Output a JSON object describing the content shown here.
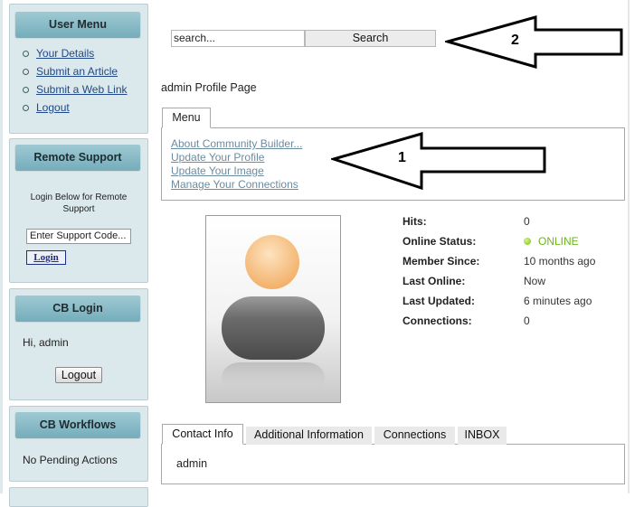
{
  "sidebar": {
    "user_menu": {
      "title": "User Menu",
      "links": [
        "Your Details",
        "Submit an Article",
        "Submit a Web Link",
        "Logout"
      ]
    },
    "remote_support": {
      "title": "Remote Support",
      "instructions": "Login Below for Remote Support",
      "code_placeholder": "Enter Support Code...",
      "login_label": "Login"
    },
    "cb_login": {
      "title": "CB Login",
      "greeting": "Hi, admin",
      "logout_label": "Logout"
    },
    "cb_workflows": {
      "title": "CB Workflows",
      "status": "No Pending Actions"
    }
  },
  "search": {
    "value": "search...",
    "button_label": "Search"
  },
  "page_title": "admin Profile Page",
  "menu": {
    "tab_label": "Menu",
    "links": [
      "About Community Builder...",
      "Update Your Profile",
      "Update Your Image",
      "Manage Your Connections"
    ]
  },
  "profile_stats": [
    {
      "label": "Hits:",
      "value": "0"
    },
    {
      "label": "Online Status:",
      "value": "ONLINE"
    },
    {
      "label": "Member Since:",
      "value": "10 months ago"
    },
    {
      "label": "Last Online:",
      "value": "Now"
    },
    {
      "label": "Last Updated:",
      "value": "6 minutes ago"
    },
    {
      "label": "Connections:",
      "value": "0"
    }
  ],
  "bottom_tabs": {
    "items": [
      "Contact Info",
      "Additional Information",
      "Connections",
      "INBOX"
    ],
    "active": "Contact Info",
    "content": "admin"
  },
  "annotations": {
    "arrow1": "1",
    "arrow2": "2"
  },
  "colors": {
    "sidebar_header": "#8cbfca",
    "online": "#6db51c",
    "link": "#204a88"
  }
}
